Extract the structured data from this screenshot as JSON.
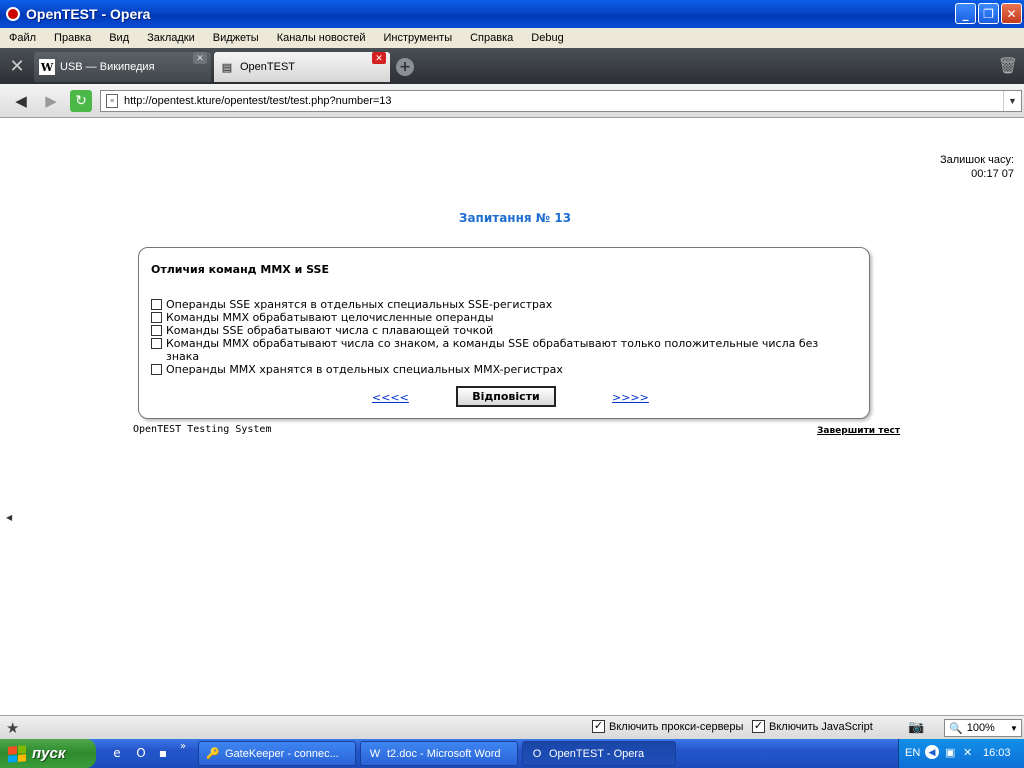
{
  "window": {
    "title": "OpenTEST - Opera"
  },
  "menu": [
    "Файл",
    "Правка",
    "Вид",
    "Закладки",
    "Виджеты",
    "Каналы новостей",
    "Инструменты",
    "Справка",
    "Debug"
  ],
  "tabs": [
    {
      "label": "USB — Википедия",
      "favicon": "W"
    },
    {
      "label": "OpenTEST",
      "favicon": "▤"
    }
  ],
  "address": {
    "url": "http://opentest.kture/opentest/test/test.php?number=13"
  },
  "timer": {
    "label": "Залишок часу:",
    "value": "00:17 07"
  },
  "question": {
    "title": "Запитання № 13",
    "text": "Отличия команд MMX и SSE",
    "options": [
      "Операнды SSE хранятся в отдельных специальных SSE-регистрах",
      "Команды MMX обрабатывают целочисленные операнды",
      "Команды SSE обрабатывают числа с плавающей точкой",
      "Команды MMX обрабатывают числа со знаком, а команды SSE обрабатывают только положительные числа без знака",
      "Операнды MMX хранятся в отдельных специальных MMX-регистрах"
    ],
    "prev": "<<<<",
    "answer_button": "Відповісти",
    "next": ">>>>"
  },
  "footer": {
    "system": "OpenTEST Testing System",
    "finish": "Завершити тест"
  },
  "statusbar": {
    "proxy": "Включить прокси-серверы",
    "javascript": "Включить JavaScript",
    "zoom": "100%"
  },
  "taskbar": {
    "start": "пуск",
    "tasks": [
      "GateKeeper - connec...",
      "t2.doc - Microsoft Word",
      "OpenTEST - Opera"
    ],
    "lang": "EN",
    "time": "16:03"
  }
}
